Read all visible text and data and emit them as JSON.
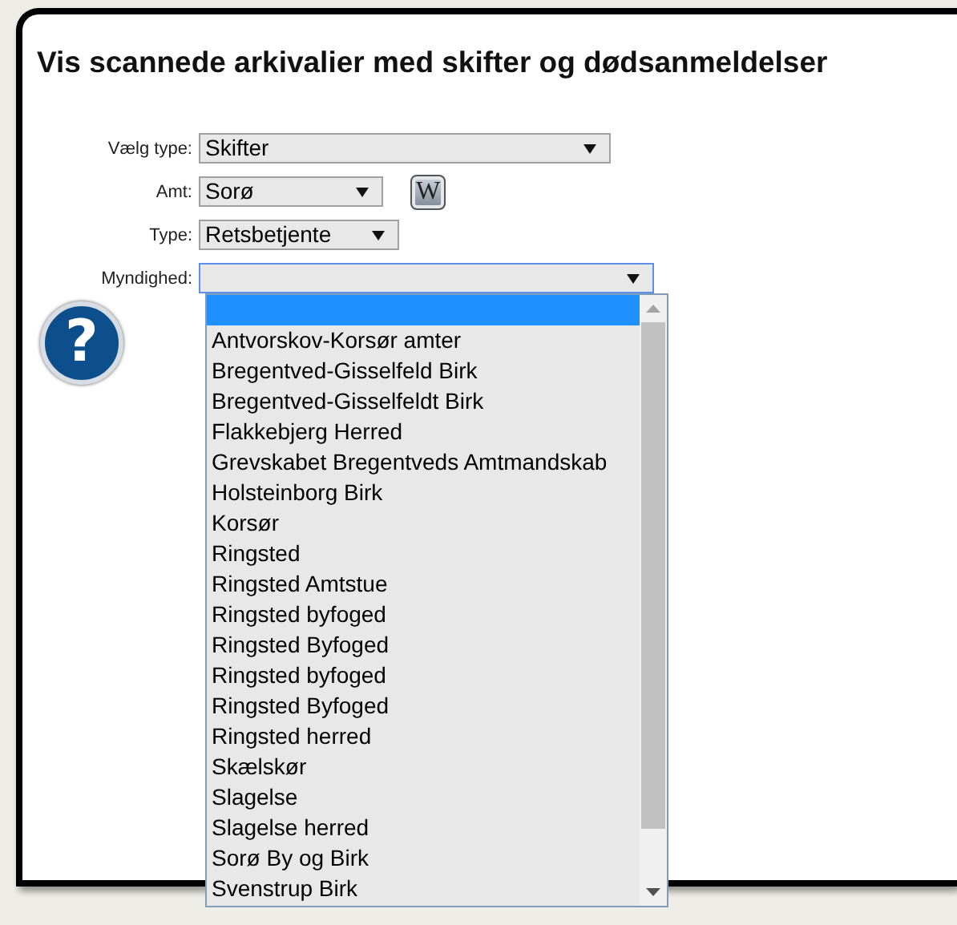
{
  "title": "Vis scannede arkivalier med skifter og dødsanmeldelser",
  "fields": [
    {
      "label": "Vælg type:",
      "value": "Skifter"
    },
    {
      "label": "Amt:",
      "value": "Sorø",
      "button": "W"
    },
    {
      "label": "Type:",
      "value": "Retsbetjente"
    },
    {
      "label": "Myndighed:",
      "focused": true
    }
  ],
  "help_button": {
    "label": "?"
  },
  "dropdown": {
    "options": [
      {
        "selected": true
      },
      {
        "label": "Antvorskov-Korsør amter",
        "selected": false
      },
      {
        "label": "Bregentved-Gisselfeld Birk",
        "selected": false
      },
      {
        "label": "Bregentved-Gisselfeldt Birk",
        "selected": false
      },
      {
        "label": "Flakkebjerg Herred",
        "selected": false
      },
      {
        "label": "Grevskabet Bregentveds Amtmandskab",
        "selected": false
      },
      {
        "label": "Holsteinborg Birk",
        "selected": false
      },
      {
        "label": "Korsør",
        "selected": false
      },
      {
        "label": "Ringsted",
        "selected": false
      },
      {
        "label": "Ringsted Amtstue",
        "selected": false
      },
      {
        "label": "Ringsted byfoged",
        "selected": false
      },
      {
        "label": "Ringsted Byfoged",
        "selected": false
      },
      {
        "label": "Ringsted byfoged",
        "selected": false
      },
      {
        "label": "Ringsted Byfoged",
        "selected": false
      },
      {
        "label": "Ringsted herred",
        "selected": false
      },
      {
        "label": "Skælskør",
        "selected": false
      },
      {
        "label": "Slagelse",
        "selected": false
      },
      {
        "label": "Slagelse herred",
        "selected": false
      },
      {
        "label": "Sorø By og Birk",
        "selected": false
      },
      {
        "label": "Svenstrup Birk",
        "selected": false
      }
    ]
  }
}
